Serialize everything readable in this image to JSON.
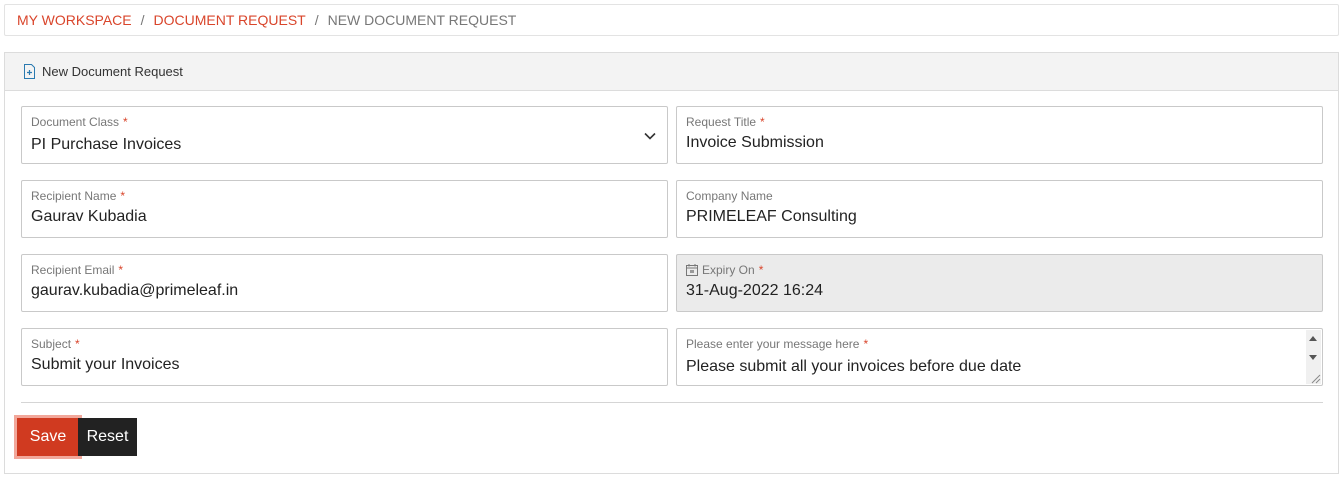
{
  "breadcrumb": {
    "items": [
      "MY WORKSPACE",
      "DOCUMENT REQUEST"
    ],
    "separator": "/",
    "current": "NEW DOCUMENT REQUEST"
  },
  "panel": {
    "title": "New Document Request",
    "icon": "document-add-icon"
  },
  "form": {
    "document_class": {
      "label": "Document Class",
      "required": "*",
      "value": "PI Purchase Invoices"
    },
    "request_title": {
      "label": "Request Title",
      "required": "*",
      "value": "Invoice Submission"
    },
    "recipient_name": {
      "label": "Recipient Name",
      "required": "*",
      "value": "Gaurav Kubadia"
    },
    "company_name": {
      "label": "Company Name",
      "value": "PRIMELEAF Consulting"
    },
    "recipient_email": {
      "label": "Recipient Email",
      "required": "*",
      "value": "gaurav.kubadia@primeleaf.in"
    },
    "expiry_on": {
      "label": "Expiry On",
      "required": "*",
      "value": "31-Aug-2022 16:24",
      "icon": "calendar-icon"
    },
    "subject": {
      "label": "Subject",
      "required": "*",
      "value": "Submit your Invoices"
    },
    "message": {
      "label": "Please enter your message here",
      "required": "*",
      "value": "Please submit all your invoices before due date"
    }
  },
  "actions": {
    "save_label": "Save",
    "reset_label": "Reset"
  },
  "colors": {
    "accent": "#d9452b",
    "save_button": "#d03a20",
    "reset_button": "#222222"
  }
}
